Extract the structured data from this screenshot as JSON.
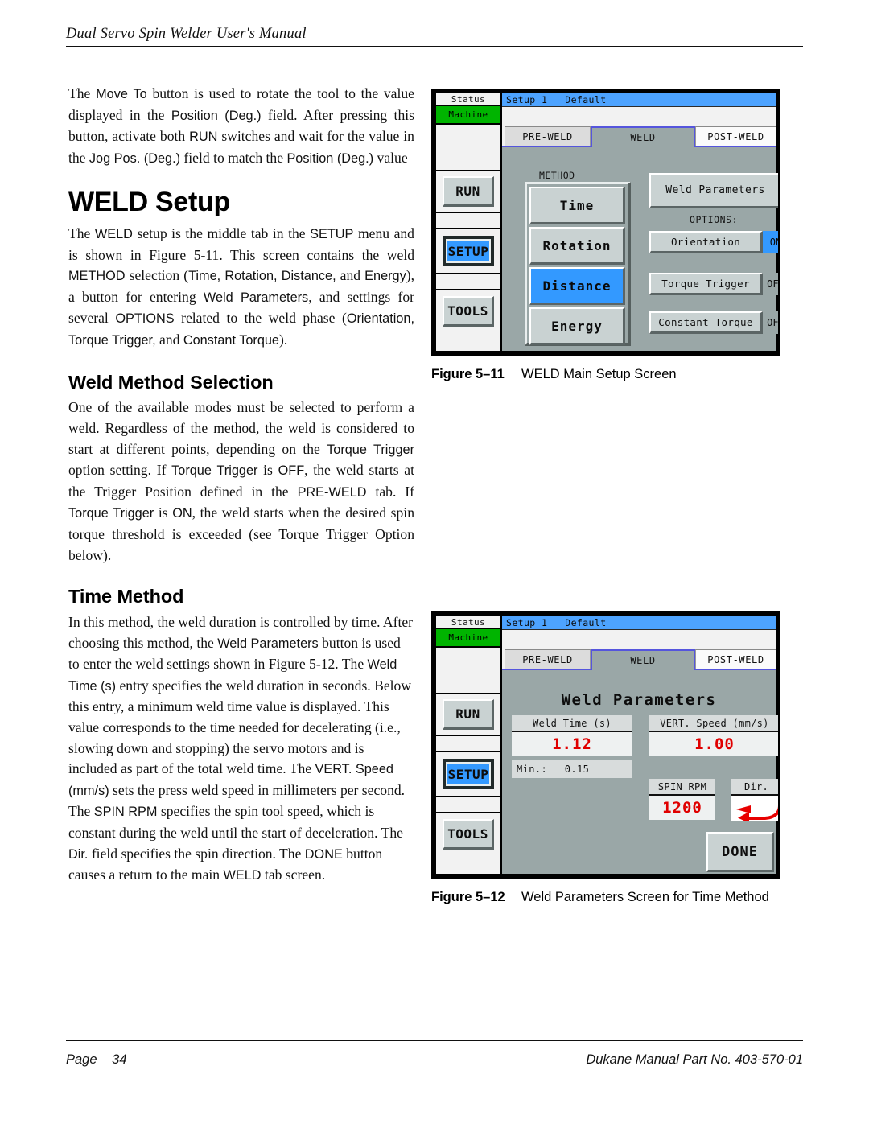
{
  "header": {
    "running_title": "Dual Servo Spin Welder User's Manual"
  },
  "body": {
    "intro_paragraph": {
      "seg1": "The ",
      "ui1": "Move To",
      "seg2": " button is used to rotate the tool to the value displayed in the ",
      "ui2": "Position (Deg.)",
      "seg3": " field. After pressing this button, activate both ",
      "ui3": "RUN",
      "seg4": " switches and wait for the value in the ",
      "ui4": "Jog Pos. (Deg.)",
      "seg5": " field to match the ",
      "ui5": "Position (Deg.)",
      "seg6": " value"
    },
    "weld_setup_heading": "WELD Setup",
    "weld_setup_paragraph": {
      "seg1": "The ",
      "ui1": "WELD",
      "seg2": " setup is the middle tab in the ",
      "ui2": "SETUP",
      "seg3": " menu and is shown in Figure 5-11. This screen contains the weld ",
      "ui3": "METHOD",
      "seg4": " selection (",
      "ui4": "Time, Rotation, Distance,",
      "seg5": " and ",
      "ui5": "Energy",
      "seg6": "), a button for entering ",
      "ui6": "Weld Parameters",
      "seg7": ", and settings for several ",
      "ui7": "OPTIONS",
      "seg8": " related to the weld phase (",
      "ui8": "Orientation, Torque Trigger,",
      "seg9": " and ",
      "ui9": "Constant Torque",
      "seg10": ")."
    },
    "weld_method_heading": "Weld Method Selection",
    "weld_method_paragraph": {
      "seg1": "One of the available modes must be selected to perform a weld. Regardless of the method, the weld is considered to start at different points, depending on the ",
      "ui1": "Torque Trigger",
      "seg2": " option setting. If ",
      "ui2": "Torque Trigger",
      "seg3": " is ",
      "ui3": "OFF",
      "seg4": ", the weld starts at the Trigger Position defined in the ",
      "ui4": "PRE-WELD",
      "seg5": " tab. If ",
      "ui5": "Torque Trigger",
      "seg6": " is ",
      "ui6": "ON",
      "seg7": ", the weld starts when the desired spin torque threshold is exceeded (see Torque Trigger Option below)."
    },
    "time_method_heading": "Time Method",
    "time_method_paragraph": {
      "seg1": "In this method, the weld duration is controlled by time. After choosing this method, the ",
      "ui1": "Weld Parameters",
      "seg2": " button is used to enter the weld settings shown in Figure 5-12. The ",
      "ui2": "Weld Time (s)",
      "seg3": " entry specifies the weld duration in seconds.  Below this entry, a minimum weld time value is displayed. This value corresponds to the time needed for decelerating (i.e., slowing down and stopping) the servo motors and is included as part of the total weld time. The ",
      "ui3": "VERT. Speed (mm/s)",
      "seg4": " sets the press weld speed in millimeters per second. The ",
      "ui4": "SPIN RPM",
      "seg5": " specifies the spin tool speed, which is constant during the weld until the start of deceleration. The ",
      "ui5": "Dir.",
      "seg6": " field specifies the spin direction. The ",
      "ui6": "DONE",
      "seg7": " button causes a return to the main ",
      "ui7": "WELD",
      "seg8": " tab screen."
    }
  },
  "figure_5_11": {
    "caption_number": "Figure 5–11",
    "caption_text": "WELD Main Setup Screen",
    "screen": {
      "sidebar": {
        "status_label": "Status",
        "machine_label": "Machine",
        "run_label": "RUN",
        "setup_label": "SETUP",
        "tools_label": "TOOLS"
      },
      "titlebar": {
        "setup_name": "Setup 1",
        "preset_name": "Default"
      },
      "tabs": [
        {
          "label": "PRE-WELD",
          "active": false
        },
        {
          "label": "WELD",
          "active": true
        },
        {
          "label": "POST-WELD",
          "active": false
        }
      ],
      "method": {
        "group_label": "METHOD",
        "buttons": [
          {
            "label": "Time",
            "selected": false
          },
          {
            "label": "Rotation",
            "selected": false
          },
          {
            "label": "Distance",
            "selected": true
          },
          {
            "label": "Energy",
            "selected": false
          }
        ]
      },
      "weld_parameters_button": "Weld Parameters",
      "options_label": "OPTIONS:",
      "options": [
        {
          "label": "Orientation",
          "state": "ON"
        },
        {
          "label": "Torque Trigger",
          "state": "OFF"
        },
        {
          "label": "Constant Torque",
          "state": "OFF"
        }
      ]
    }
  },
  "figure_5_12": {
    "caption_number": "Figure 5–12",
    "caption_text": "Weld Parameters Screen for Time Method",
    "screen": {
      "sidebar": {
        "status_label": "Status",
        "machine_label": "Machine",
        "run_label": "RUN",
        "setup_label": "SETUP",
        "tools_label": "TOOLS"
      },
      "titlebar": {
        "setup_name": "Setup 1",
        "preset_name": "Default"
      },
      "tabs": [
        {
          "label": "PRE-WELD",
          "active": false
        },
        {
          "label": "WELD",
          "active": true
        },
        {
          "label": "POST-WELD",
          "active": false
        }
      ],
      "panel_title": "Weld Parameters",
      "weld_time": {
        "header": "Weld Time (s)",
        "value": "1.12",
        "min_label": "Min.:",
        "min_value": "0.15"
      },
      "vert_speed": {
        "header": "VERT. Speed (mm/s)",
        "value": "1.00"
      },
      "spin_rpm": {
        "header": "SPIN RPM",
        "value": "1200"
      },
      "direction": {
        "header": "Dir.",
        "icon": "curved-arrow-ccw-icon"
      },
      "done_button": "DONE"
    }
  },
  "footer": {
    "page_label": "Page",
    "page_number": "34",
    "part_info": "Dukane Manual Part No. 403-570-01"
  },
  "colors": {
    "accent_blue": "#3399ff",
    "titlebar_blue": "#4da3ff",
    "machine_green": "#00b400",
    "value_red": "#e00000",
    "panel_gray": "#9aa7a7"
  }
}
